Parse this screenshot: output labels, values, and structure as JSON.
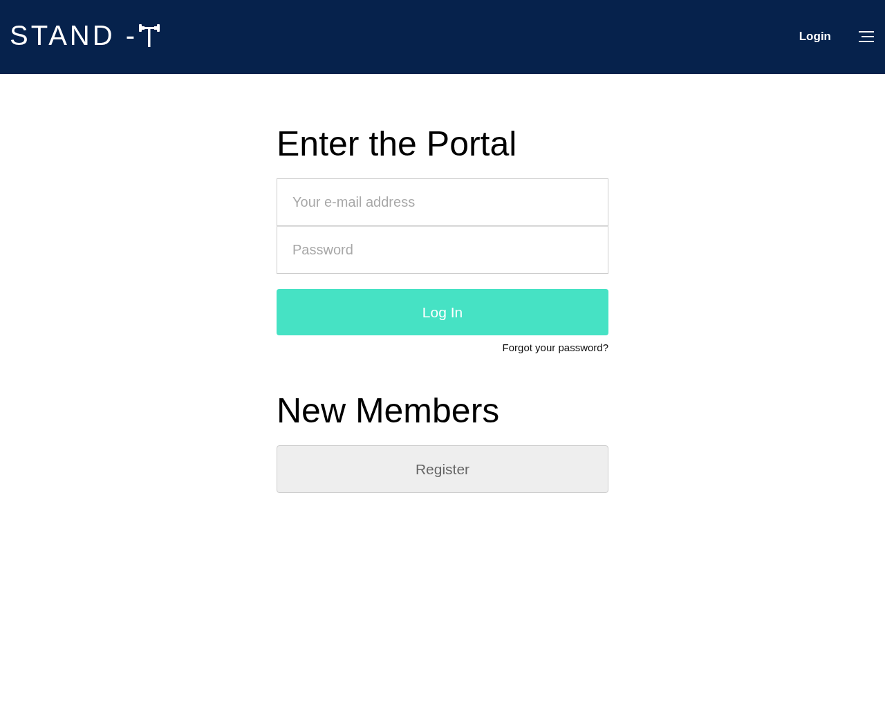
{
  "header": {
    "logo": "STAND -",
    "nav_link": "Login"
  },
  "login": {
    "title": "Enter the Portal",
    "email": {
      "placeholder": "Your e-mail address"
    },
    "password": {
      "placeholder": "Password"
    },
    "submit": "Log In",
    "forgot": "Forgot your password?"
  },
  "register": {
    "title": "New Members",
    "button": "Register"
  }
}
